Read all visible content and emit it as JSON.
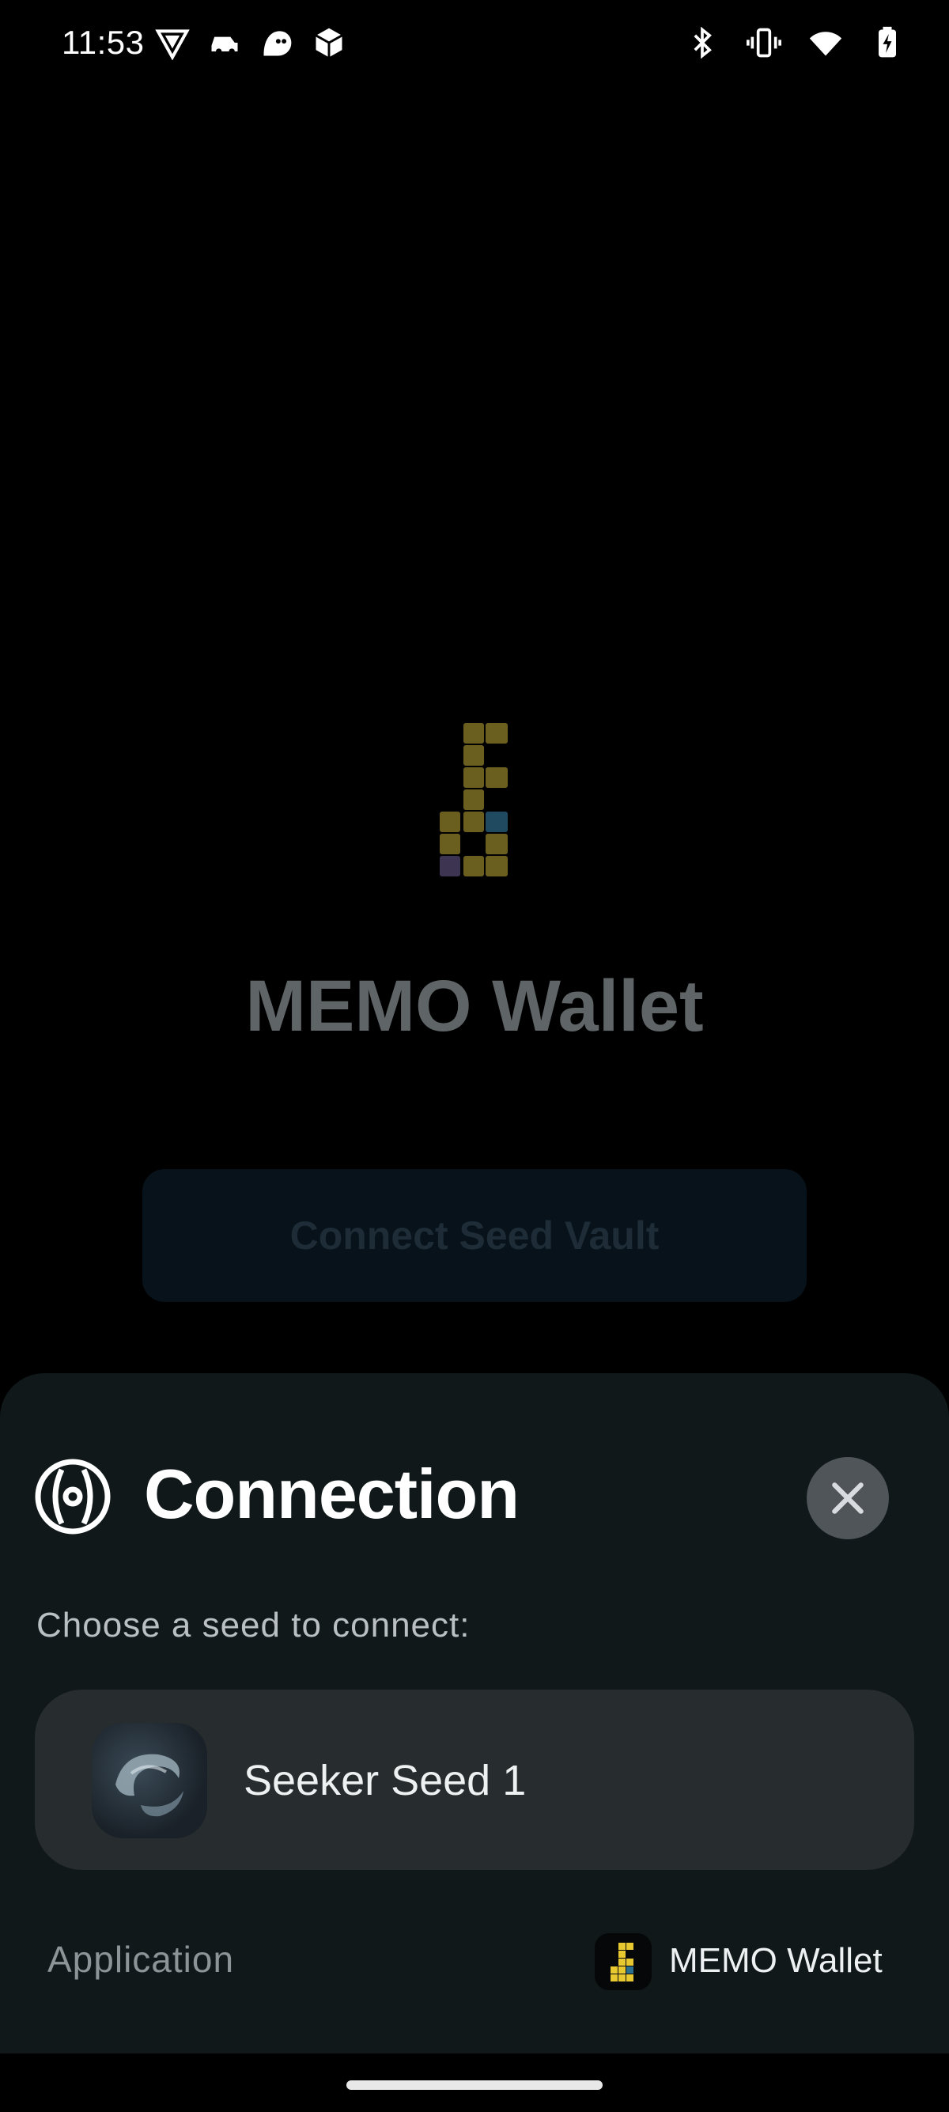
{
  "status_bar": {
    "time": "11:53",
    "left_icons": [
      "vpn-shield-icon",
      "car-icon",
      "ghost-icon",
      "cube-icon"
    ],
    "right_icons": [
      "bluetooth-icon",
      "vibrate-icon",
      "wifi-icon",
      "battery-charging-icon"
    ]
  },
  "app": {
    "title": "MEMO Wallet",
    "connect_button_label": "Connect Seed Vault",
    "logo_icon": "memo-key-logo"
  },
  "sheet": {
    "title": "Connection",
    "icon": "seed-vault-icon",
    "prompt": "Choose a seed to connect:",
    "seeds": [
      {
        "label": "Seeker Seed 1"
      }
    ],
    "application_label": "Application",
    "application_name": "MEMO Wallet"
  },
  "colors": {
    "sheet_bg": "#11181a",
    "card_bg": "#272c2e",
    "logo_gold": "#6b5f1f",
    "logo_blue": "#1f4a60"
  }
}
